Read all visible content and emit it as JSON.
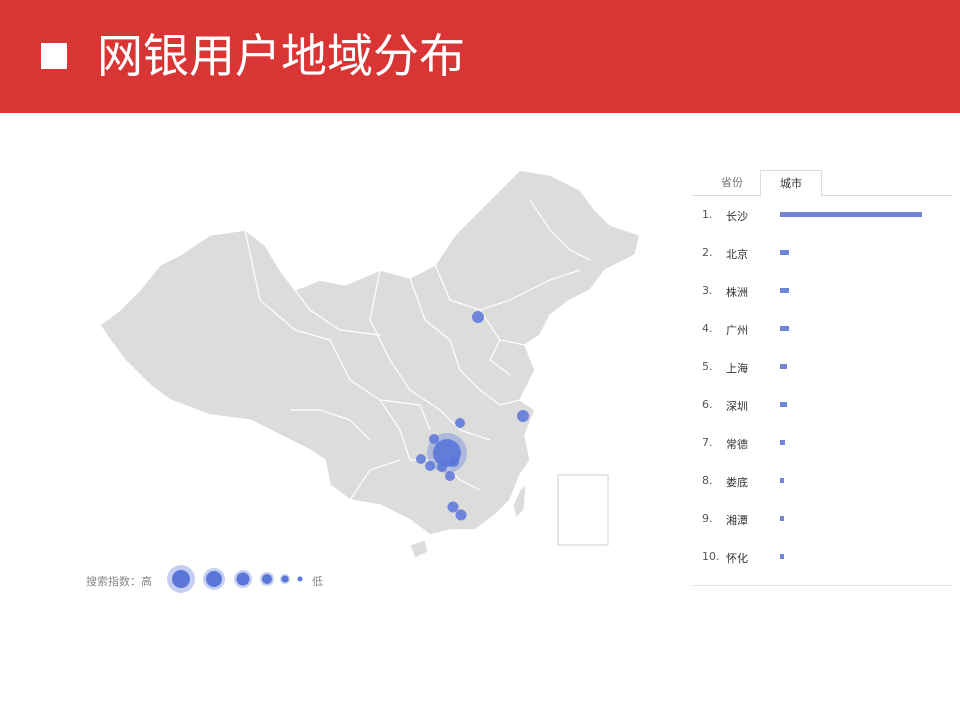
{
  "title": {
    "text": "网银用户地域分布"
  },
  "colors": {
    "header": "#d93535",
    "map_fill": "#dcdcdc",
    "bubble": "#5a76d8",
    "bar": "#6f86d6"
  },
  "map": {
    "legend": {
      "label": "搜索指数：高",
      "low": "低"
    },
    "bubbles": [
      {
        "city": "长沙",
        "size": 1.0
      },
      {
        "city": "北京",
        "size": 0.3
      },
      {
        "city": "株洲",
        "size": 0.35
      },
      {
        "city": "广州",
        "size": 0.3
      },
      {
        "city": "上海",
        "size": 0.3
      },
      {
        "city": "深圳",
        "size": 0.28
      },
      {
        "city": "常德",
        "size": 0.28
      },
      {
        "city": "娄底",
        "size": 0.25
      },
      {
        "city": "湘潭",
        "size": 0.3
      },
      {
        "city": "怀化",
        "size": 0.25
      }
    ]
  },
  "chart_data": {
    "type": "bar",
    "tabs": [
      "省份",
      "城市"
    ],
    "active_tab": "城市",
    "categories": [
      "长沙",
      "北京",
      "株洲",
      "广州",
      "上海",
      "深圳",
      "常德",
      "娄底",
      "湘潭",
      "怀化"
    ],
    "ranks": [
      "1.",
      "2.",
      "3.",
      "4.",
      "5.",
      "6.",
      "7.",
      "8.",
      "9.",
      "10."
    ],
    "values": [
      100,
      6.5,
      6.3,
      6.3,
      4.6,
      4.6,
      3.5,
      2.8,
      2.8,
      2.8
    ]
  }
}
